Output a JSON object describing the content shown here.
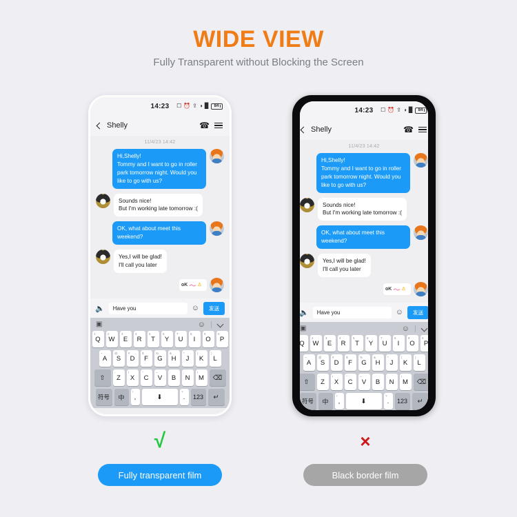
{
  "header": {
    "title": "WIDE VIEW",
    "subtitle": "Fully Transparent without Blocking the Screen"
  },
  "phone": {
    "status_bar": {
      "time": "14:23",
      "icons": [
        "nfc-icon",
        "alarm-icon",
        "bluetooth-icon",
        "wifi-icon",
        "signal-icon"
      ],
      "battery_level": "84"
    },
    "app_header": {
      "back": "back-chevron-icon",
      "contact_name": "Shelly",
      "call_icon": "☎",
      "menu_icon": "hamburger-menu-icon"
    },
    "chat": {
      "date_divider": "11/4/23 14:42",
      "messages": [
        {
          "side": "out",
          "avatar": "boy",
          "text": "Hi,Shelly!\nTommy and I want to go in roller park tomorrow night. Would you like to go with us?"
        },
        {
          "side": "in",
          "avatar": "dog",
          "text": "Sounds nice!\nBut I'm working late tomorrow :("
        },
        {
          "side": "out",
          "avatar": "boy",
          "text": "OK, what about meet this weekend?"
        },
        {
          "side": "in",
          "avatar": "dog",
          "text": "Yes,I will be glad!\nI'll call you later"
        }
      ],
      "sticker": {
        "label": "oK",
        "squiggle": "〜",
        "bell": "♙"
      }
    },
    "input_bar": {
      "mic_icon": "Ƭ",
      "text_value": "Have you",
      "placeholder": "Have you",
      "emoji_icon": "☺",
      "send_label": "发送"
    },
    "keyboard": {
      "toolbar": {
        "left_icon": "sticker-panel-icon",
        "emoji_icon": "☺",
        "collapse_icon": "chevron-down-icon"
      },
      "row1": [
        {
          "key": "Q",
          "sup": "1"
        },
        {
          "key": "W",
          "sup": "2"
        },
        {
          "key": "E",
          "sup": "3"
        },
        {
          "key": "R",
          "sup": "4"
        },
        {
          "key": "T",
          "sup": "5"
        },
        {
          "key": "Y",
          "sup": "6"
        },
        {
          "key": "U",
          "sup": "7"
        },
        {
          "key": "I",
          "sup": "8"
        },
        {
          "key": "O",
          "sup": "9"
        },
        {
          "key": "P",
          "sup": "0"
        }
      ],
      "row2": [
        {
          "key": "A",
          "sup": "~"
        },
        {
          "key": "S",
          "sup": "@"
        },
        {
          "key": "D",
          "sup": "#"
        },
        {
          "key": "F",
          "sup": "$"
        },
        {
          "key": "G",
          "sup": "%"
        },
        {
          "key": "H",
          "sup": "&"
        },
        {
          "key": "J",
          "sup": "*"
        },
        {
          "key": "K",
          "sup": "("
        },
        {
          "key": "L",
          "sup": ")"
        }
      ],
      "row3": {
        "shift": "⇧",
        "keys": [
          {
            "key": "Z",
            "sup": "-"
          },
          {
            "key": "X",
            "sup": "/"
          },
          {
            "key": "C",
            "sup": "\""
          },
          {
            "key": "V",
            "sup": "~"
          },
          {
            "key": "B",
            "sup": ":"
          },
          {
            "key": "N",
            "sup": ";"
          },
          {
            "key": "M",
            "sup": "!"
          }
        ],
        "backspace": "⌫"
      },
      "row4": {
        "symbols": "符号",
        "lang": "中",
        "comma_sup": "!",
        "comma": ",",
        "space_icon": "⬇",
        "period_sup": "?",
        "period": ".",
        "numbers": "123",
        "enter": "↵"
      }
    }
  },
  "footer": {
    "good": {
      "mark": "√",
      "label": "Fully transparent film",
      "color": "#1b9af7"
    },
    "bad": {
      "mark": "×",
      "label": "Black border film",
      "color": "#a6a6a6"
    }
  }
}
